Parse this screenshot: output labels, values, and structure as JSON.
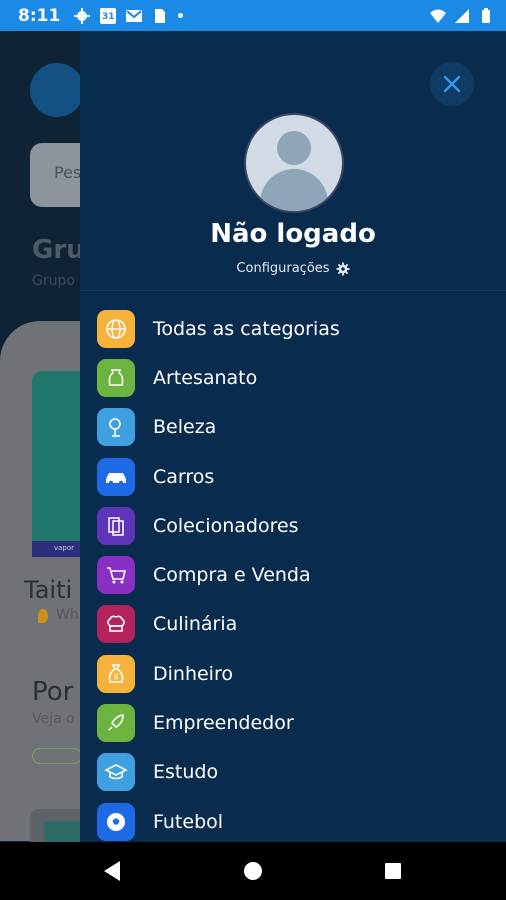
{
  "status_bar": {
    "time": "8:11",
    "calendar_day": "31"
  },
  "background_app": {
    "search_placeholder": "Pes",
    "section_title": "Gru",
    "section_subtitle": "Grupo",
    "card_title": "Taiti",
    "card_location": "Wh",
    "card_tag": "vapor",
    "section2_title": "Por",
    "section2_subtitle": "Veja o"
  },
  "drawer": {
    "user_name": "Não logado",
    "settings_label": "Configurações",
    "categories": [
      {
        "label": "Todas as categorias",
        "icon": "globe-icon",
        "color": "#f7b23b"
      },
      {
        "label": "Artesanato",
        "icon": "pottery-icon",
        "color": "#6cb33f"
      },
      {
        "label": "Beleza",
        "icon": "beauty-face-icon",
        "color": "#3ea0e0"
      },
      {
        "label": "Carros",
        "icon": "car-icon",
        "color": "#1e6ae6"
      },
      {
        "label": "Colecionadores",
        "icon": "collector-cards-icon",
        "color": "#5e34b8"
      },
      {
        "label": "Compra e Venda",
        "icon": "shopping-cart-icon",
        "color": "#8a2fc4"
      },
      {
        "label": "Culinária",
        "icon": "chef-hat-icon",
        "color": "#b5235c"
      },
      {
        "label": "Dinheiro",
        "icon": "money-bag-icon",
        "color": "#f7b23b"
      },
      {
        "label": "Empreendedor",
        "icon": "rocket-icon",
        "color": "#6cb33f"
      },
      {
        "label": "Estudo",
        "icon": "graduation-cap-icon",
        "color": "#3ea0e0"
      },
      {
        "label": "Futebol",
        "icon": "soccer-ball-icon",
        "color": "#1e6ae6"
      }
    ]
  }
}
